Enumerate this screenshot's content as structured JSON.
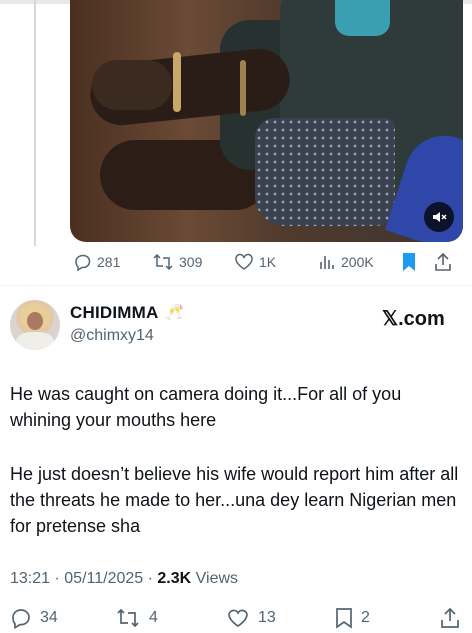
{
  "quoted_post": {
    "video": {
      "mute_icon": "muted-speaker-icon"
    },
    "actions": {
      "replies": "281",
      "reposts": "309",
      "likes": "1K",
      "views": "200K"
    }
  },
  "post": {
    "author": {
      "display_name": "CHIDIMMA",
      "name_emoji": "🥂",
      "handle": "@chimxy14"
    },
    "brand": "𝕏.com",
    "paragraphs": [
      "He was caught on camera doing it...For all of you whining your mouths here",
      "He just doesn’t believe his wife would report him after all the threats he made to her...una dey learn Nigerian men for pretense sha"
    ],
    "meta": {
      "time": "13:21",
      "separator": "·",
      "date": "05/11/2025",
      "views_count": "2.3K",
      "views_label": "Views"
    },
    "actions": {
      "replies": "34",
      "reposts": "4",
      "likes": "13",
      "bookmarks": "2"
    }
  },
  "colors": {
    "text": "#0f1419",
    "secondary": "#536471",
    "bookmark_active": "#1d9bf0"
  }
}
